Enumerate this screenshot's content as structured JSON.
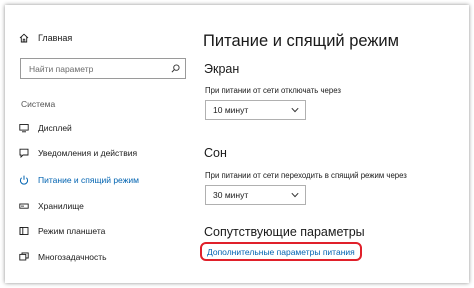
{
  "sidebar": {
    "home_label": "Главная",
    "search": {
      "placeholder": "Найти параметр"
    },
    "section_title": "Система",
    "items": [
      {
        "label": "Дисплей",
        "icon": "monitor-icon"
      },
      {
        "label": "Уведомления и действия",
        "icon": "notification-icon"
      },
      {
        "label": "Питание и спящий режим",
        "icon": "power-icon",
        "active": true
      },
      {
        "label": "Хранилище",
        "icon": "storage-icon"
      },
      {
        "label": "Режим планшета",
        "icon": "tablet-icon"
      },
      {
        "label": "Многозадачность",
        "icon": "multitasking-icon"
      }
    ]
  },
  "main": {
    "title": "Питание и спящий режим",
    "screen": {
      "heading": "Экран",
      "label": "При питании от сети отключать через",
      "value": "10 минут"
    },
    "sleep": {
      "heading": "Сон",
      "label": "При питании от сети переходить в спящий режим через",
      "value": "30 минут"
    },
    "related": {
      "heading": "Сопутствующие параметры",
      "link": "Дополнительные параметры питания"
    }
  },
  "colors": {
    "accent": "#0063b1",
    "highlight": "#e0202a"
  }
}
